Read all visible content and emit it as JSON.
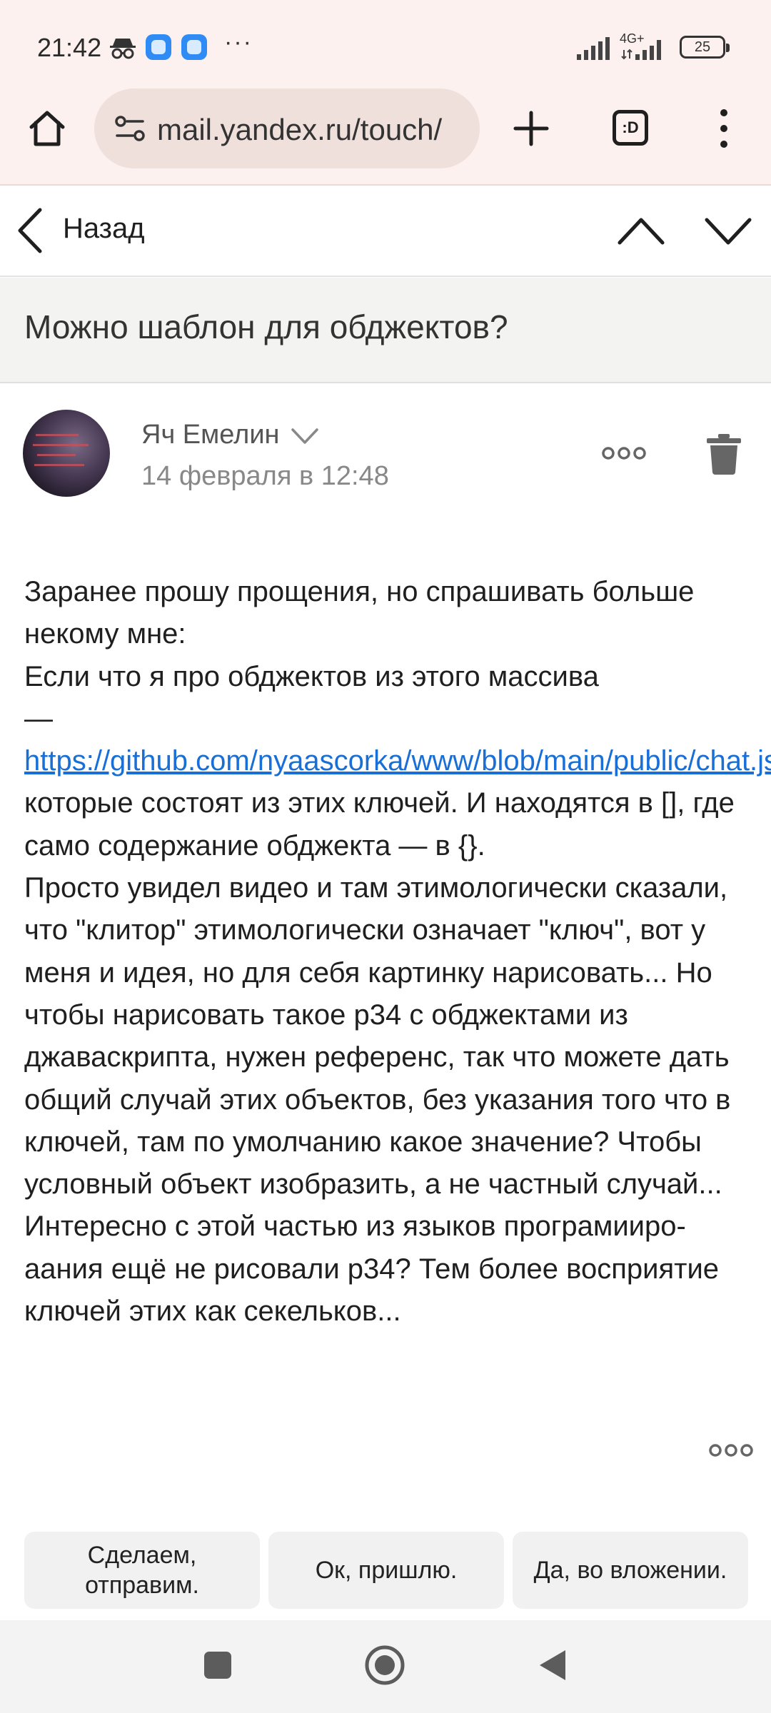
{
  "status_bar": {
    "time": "21:42",
    "more": "···",
    "network": "4G+",
    "battery": "25"
  },
  "browser": {
    "url": "mail.yandex.ru/touch/",
    "tabs_label": ":D"
  },
  "mail_nav": {
    "back_label": "Назад"
  },
  "message": {
    "subject": "Можно шаблон для обджектов?",
    "sender_name": "Яч Емелин",
    "date": "14 февраля в 12:48",
    "body_intro": "Заранее прошу прощения, но спрашивать больше некому мне:\nЕсли что я про обджектов из этого массива\n— ",
    "link_text": "https://github.com/nyaascorka/www/blob/main/public/chat.json",
    "body_rest": "которые состоят из этих ключей. И находятся в [], где само содержание обджекта — в {}.\nПросто увидел видео и там этимологически сказали, что \"клитор\" этимологически означает \"ключ\", вот у меня и идея, но для себя картинку нарисовать... Но чтобы нарисовать такое р34 с обджектами из джаваскрипта, нужен референс, так что можете дать общий случай этих объектов, без указания того что в ключей, там по умолчанию какое значение? Чтобы условный объект изобразить, а не частный случай...\nИнтересно с этой частью из языков програмииро­аания ещё не рисовали р34? Тем более восприятие ключей этих как секельков..."
  },
  "quick_replies": [
    "Сделаем, отправим.",
    "Ок, пришлю.",
    "Да, во вложении."
  ],
  "colors": {
    "chrome_bg": "#fcf1ee",
    "url_pill": "#efe0dc",
    "link": "#1a6fd6",
    "subject_bg": "#f3f3f2"
  }
}
